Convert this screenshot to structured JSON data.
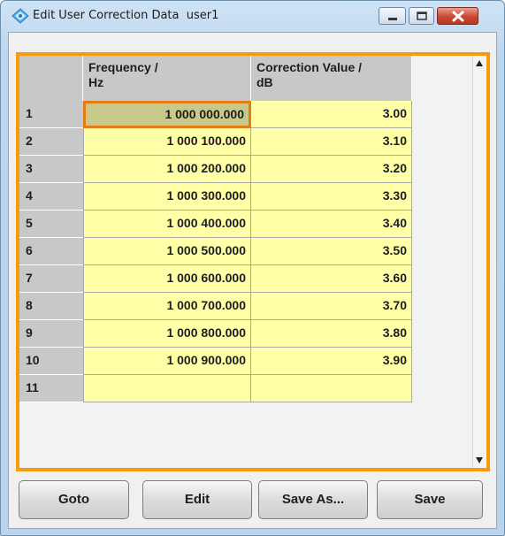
{
  "window": {
    "title": "Edit User Correction Data  user1",
    "icon": "diamond-app-icon",
    "controls": [
      "minimize-icon",
      "maximize-icon",
      "close-icon"
    ]
  },
  "table": {
    "headers": {
      "index": "",
      "frequency": "Frequency /\nHz",
      "correction": "Correction Value /\ndB"
    },
    "rows": [
      {
        "index": "1",
        "frequency": "1 000 000.000",
        "correction": "3.00"
      },
      {
        "index": "2",
        "frequency": "1 000 100.000",
        "correction": "3.10"
      },
      {
        "index": "3",
        "frequency": "1 000 200.000",
        "correction": "3.20"
      },
      {
        "index": "4",
        "frequency": "1 000 300.000",
        "correction": "3.30"
      },
      {
        "index": "5",
        "frequency": "1 000 400.000",
        "correction": "3.40"
      },
      {
        "index": "6",
        "frequency": "1 000 500.000",
        "correction": "3.50"
      },
      {
        "index": "7",
        "frequency": "1 000 600.000",
        "correction": "3.60"
      },
      {
        "index": "8",
        "frequency": "1 000 700.000",
        "correction": "3.70"
      },
      {
        "index": "9",
        "frequency": "1 000 800.000",
        "correction": "3.80"
      },
      {
        "index": "10",
        "frequency": "1 000 900.000",
        "correction": "3.90"
      },
      {
        "index": "11",
        "frequency": "",
        "correction": ""
      }
    ]
  },
  "buttons": {
    "goto": "Goto",
    "edit": "Edit",
    "save_as": "Save As...",
    "save": "Save"
  },
  "colors": {
    "focus_frame": "#f59b0d",
    "cell_bg": "#ffffa8",
    "selected_cell_bg": "#c7c98a",
    "header_bg": "#c8c8c8"
  }
}
